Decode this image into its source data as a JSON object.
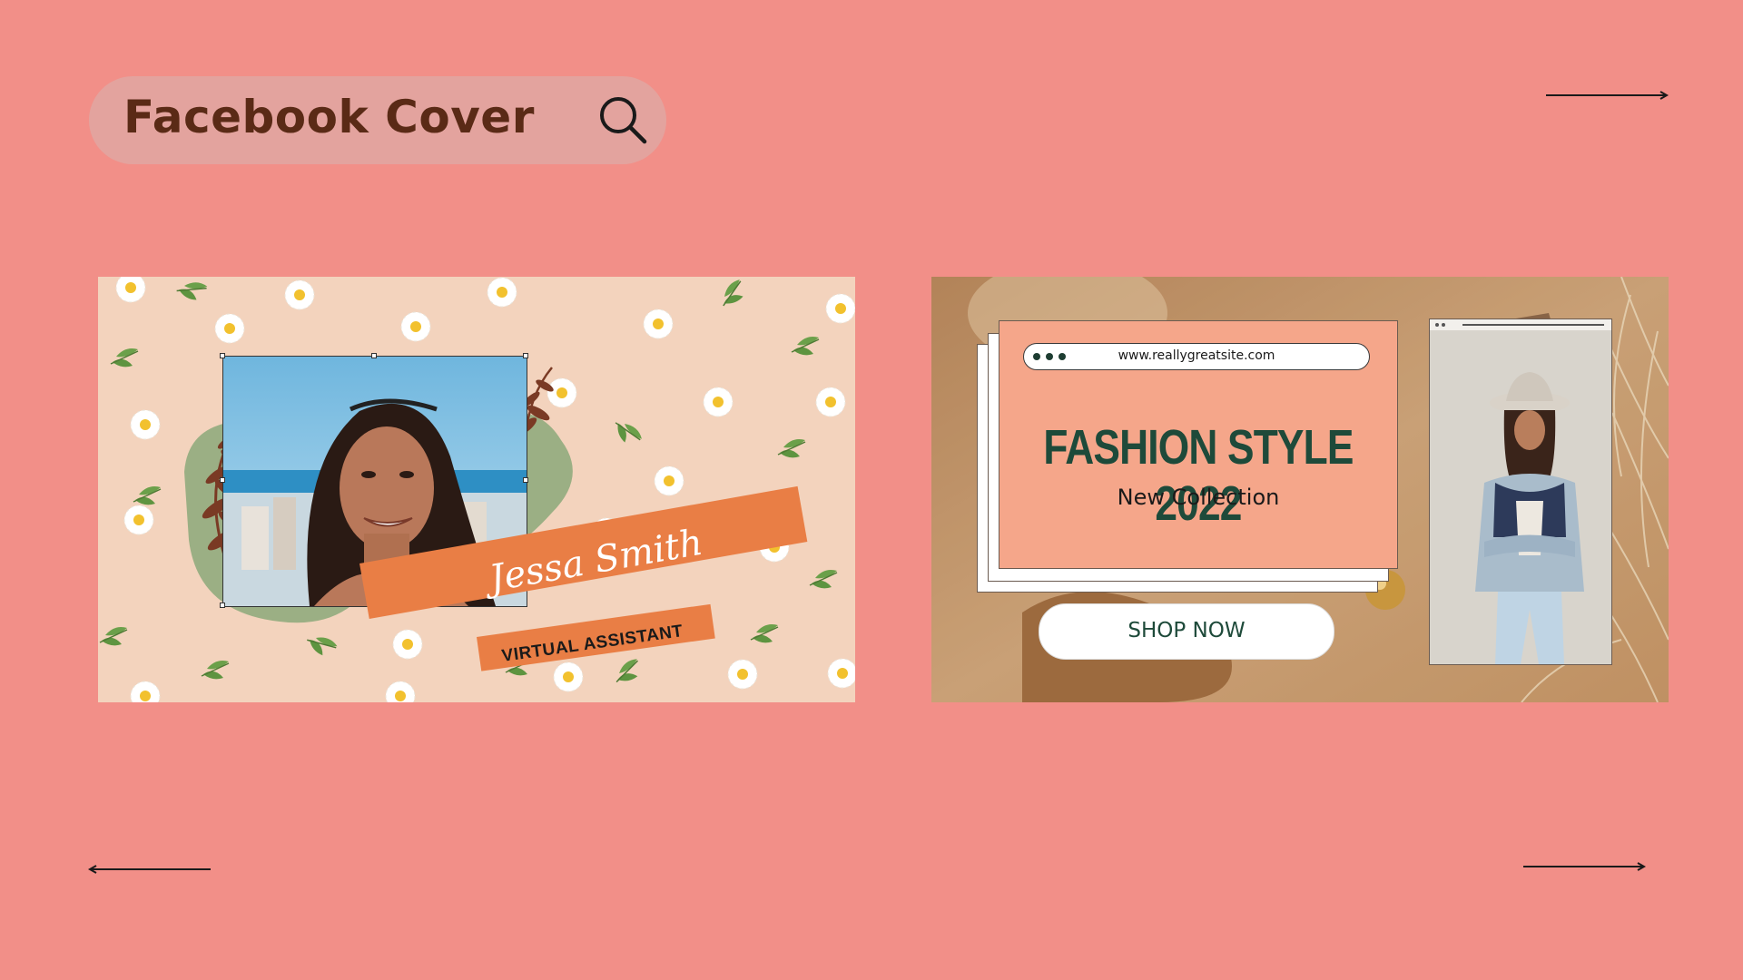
{
  "header": {
    "title": "Facebook Cover",
    "search_icon": "search-icon"
  },
  "nav": {
    "next_arrow_top": "arrow-right-icon",
    "prev_arrow_bottom": "arrow-left-icon",
    "next_arrow_bottom": "arrow-right-icon"
  },
  "templates": [
    {
      "name": "Jessa Smith",
      "role": "VIRTUAL ASSISTANT",
      "accent": "#E97E45",
      "background": "#F3D3BD"
    },
    {
      "url": "www.reallygreatsite.com",
      "title": "FASHION STYLE 2022",
      "subtitle": "New Collection",
      "cta": "SHOP NOW",
      "accent": "#F5A68A",
      "title_color": "#1E4A3A"
    }
  ],
  "colors": {
    "page_background": "#F28F88",
    "search_pill": "#E3A39E",
    "title_text": "#5A2A16"
  }
}
